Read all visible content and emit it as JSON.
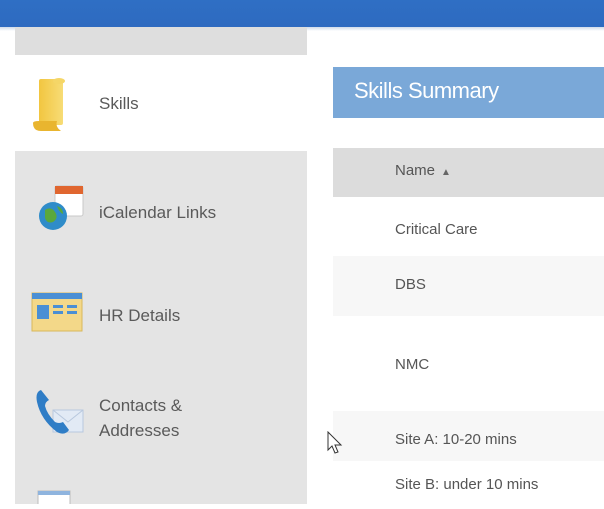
{
  "sidebar": {
    "items": [
      {
        "label": "Skills",
        "icon": "scroll-icon",
        "active": true
      },
      {
        "label": "iCalendar Links",
        "icon": "calendar-globe-icon",
        "active": false
      },
      {
        "label": "HR Details",
        "icon": "id-card-icon",
        "active": false
      },
      {
        "label": "Contacts &",
        "label2": "Addresses",
        "icon": "phone-envelope-icon",
        "active": false
      },
      {
        "label": "",
        "icon": "document-icon",
        "active": false
      }
    ]
  },
  "main": {
    "summary_title": "Skills Summary",
    "table": {
      "column_header": "Name",
      "sort_indicator": "▲",
      "rows": [
        "Critical Care",
        "DBS",
        "NMC",
        "Site A: 10-20 mins",
        "Site B: under 10 mins"
      ]
    }
  },
  "colors": {
    "topbar": "#2f6fc4",
    "summary_bar": "#7aa8d8",
    "sidebar_bg": "#e4e4e4"
  }
}
